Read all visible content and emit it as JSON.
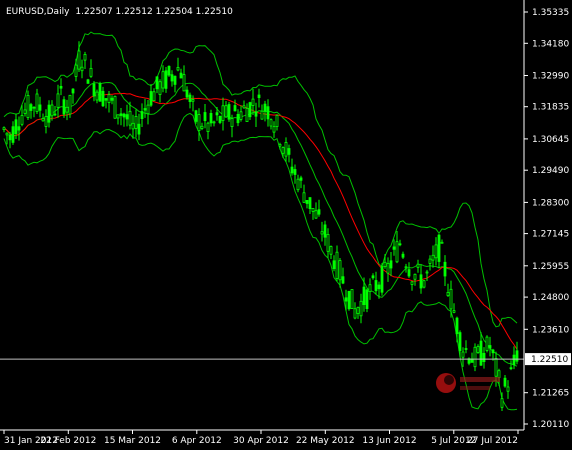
{
  "chart_data": {
    "type": "candlestick",
    "header": {
      "symbol_timeframe": "EURUSD,Daily",
      "ohlc": "1.22507 1.22512 1.22504 1.22510"
    },
    "y_ticks": [
      "1.35335",
      "1.34180",
      "1.32990",
      "1.31835",
      "1.30645",
      "1.29490",
      "1.28300",
      "1.27145",
      "1.25955",
      "1.24800",
      "1.23610",
      "1.22510",
      "1.21265",
      "1.20110"
    ],
    "x_ticks": [
      "31 Jan 2012",
      "22 Feb 2012",
      "15 Mar 2012",
      "6 Apr 2012",
      "30 Apr 2012",
      "22 May 2012",
      "13 Jun 2012",
      "5 Jul 2012",
      "27 Jul 2012"
    ],
    "current_price": 1.2251,
    "current_price_label": "1.22510",
    "ylim": [
      1.2011,
      1.35335
    ],
    "colors": {
      "background": "#000000",
      "candles": "#00ff00",
      "bollinger": "#00c000",
      "moving_average": "#ff0000",
      "current_price_line": "#c0c0c0",
      "axis": "#ffffff"
    },
    "watermark": "logo"
  }
}
